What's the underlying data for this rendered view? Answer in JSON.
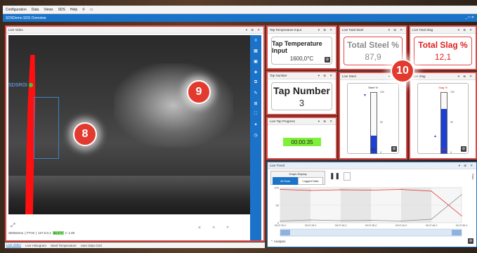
{
  "menu": [
    "Configuration",
    "Data",
    "Views",
    "SDS",
    "Help"
  ],
  "app_title": "SDSDemo SDS Overview",
  "window_controls": "_ □ ✕",
  "live_video": {
    "title": "Live Video",
    "roi_label": "SDSROI",
    "badge_a": "8",
    "badge_b": "9",
    "coords": [
      "X:",
      "Y:",
      "T:"
    ],
    "status_name": "SDSDemo",
    "status_device": "( FTI-E )",
    "status_ip": "127.0.0.1",
    "status_value": "34.1°C",
    "status_zoom": "z: 1.00"
  },
  "tabs": [
    {
      "label": "Live Video",
      "active": true
    },
    {
      "label": "Live Histogram",
      "active": false
    },
    {
      "label": "Steel Temperature",
      "active": false
    },
    {
      "label": "User Data Grid",
      "active": false
    }
  ],
  "tap_temperature": {
    "header": "Tap Temperature Input",
    "title": "Tap Temperature Input",
    "value": "1600,0°C"
  },
  "tap_number": {
    "header": "Tap Number",
    "title": "Tap Number",
    "value": "3"
  },
  "tap_progress": {
    "header": "Live Tap Progress",
    "value": "00:00:35"
  },
  "total_steel": {
    "header": "Live Total Steel",
    "title": "Total Steel %",
    "value": "87,9"
  },
  "total_slag": {
    "header": "Live Total Slag",
    "title": "Total Slag %",
    "value": "12,1"
  },
  "badge_c": "10",
  "live_steel": {
    "header": "Live Steel",
    "gauge_title": "Steel %",
    "value": "28.7",
    "fill_percent": 28.7,
    "ticks": [
      "100",
      "50",
      "0"
    ],
    "color": "#1c3fd6"
  },
  "live_slag": {
    "header": "Live Slag",
    "gauge_title": "Slag %",
    "value": "73.3",
    "fill_percent": 73.3,
    "ticks": [
      "100",
      "50",
      "0"
    ],
    "color": "#1c3fd6"
  },
  "live_trend": {
    "header": "Live Trend",
    "graph_display_label": "Graph Display",
    "all_data_label": "All Data",
    "logged_data_label": "Logged Data",
    "y_ticks": [
      "100",
      "50",
      "0"
    ],
    "x_ticks": [
      "09:07:20.0",
      "09:07:25.0",
      "09:07:30.0",
      "09:07:35.0",
      "09:07:40.0",
      "09:07:45.0",
      "09:07:50.0"
    ],
    "analysis_label": "Analysis",
    "side_label": "Data"
  },
  "chart_data": {
    "type": "line",
    "x": [
      "09:07:20.0",
      "09:07:25.0",
      "09:07:30.0",
      "09:07:35.0",
      "09:07:40.0",
      "09:07:45.0",
      "09:07:50.0"
    ],
    "series": [
      {
        "values": [
          95,
          92,
          94,
          93,
          95,
          90,
          20
        ],
        "color": "#e02b2b"
      },
      {
        "values": [
          5,
          8,
          6,
          7,
          5,
          10,
          80
        ],
        "color": "#888888"
      }
    ],
    "ylim": [
      0,
      100
    ]
  }
}
